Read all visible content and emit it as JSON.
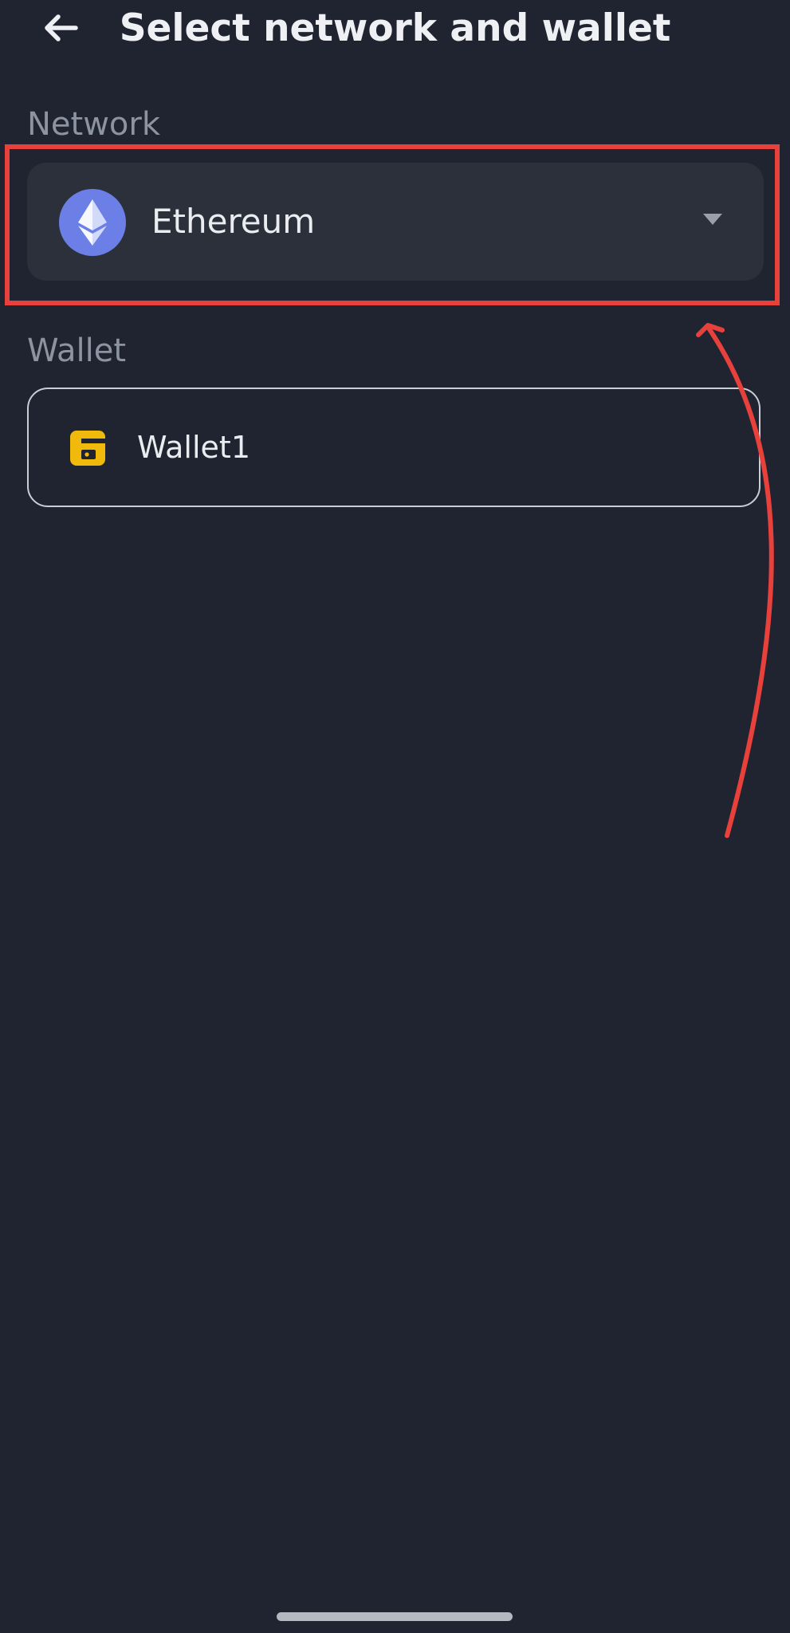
{
  "header": {
    "title": "Select network and wallet",
    "back_icon": "arrow-left-icon"
  },
  "network": {
    "label": "Network",
    "selected": "Ethereum",
    "icon": "ethereum-icon",
    "icon_color": "#6c7fe6",
    "dropdown_icon": "chevron-down-icon"
  },
  "wallet": {
    "label": "Wallet",
    "items": [
      {
        "name": "Wallet1",
        "icon": "wallet-icon",
        "icon_color": "#f0b90b"
      }
    ]
  },
  "colors": {
    "background": "#1f2430",
    "annotation": "#e8413c"
  }
}
